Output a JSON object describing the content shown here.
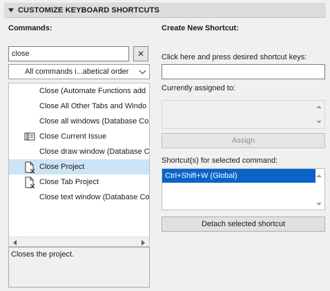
{
  "header": {
    "title": "CUSTOMIZE KEYBOARD SHORTCUTS"
  },
  "commands": {
    "label": "Commands:",
    "search_value": "close",
    "clear_glyph": "✕",
    "filter_value": "All commands i...abetical order",
    "items": [
      {
        "label": "Close (Automate Functions add",
        "icon": "",
        "selected": false
      },
      {
        "label": "Close All Other Tabs and Windo",
        "icon": "",
        "selected": false
      },
      {
        "label": "Close all windows (Database Co",
        "icon": "",
        "selected": false
      },
      {
        "label": "Close Current Issue",
        "icon": "issue-manager-icon",
        "selected": false
      },
      {
        "label": "Close draw window (Database C",
        "icon": "",
        "selected": false
      },
      {
        "label": "Close Project",
        "icon": "close-document-icon",
        "selected": true
      },
      {
        "label": "Close Tab Project",
        "icon": "close-document-icon",
        "selected": false
      },
      {
        "label": "Close text window (Database Co",
        "icon": "",
        "selected": false
      }
    ],
    "description": "Closes the project."
  },
  "create": {
    "label": "Create New Shortcut:",
    "press_prompt": "Click here and press desired shortcut keys:",
    "shortcut_value": "",
    "assigned_label": "Currently assigned to:",
    "assign_button": "Assign",
    "selected_shortcuts_label": "Shortcut(s) for selected command:",
    "shortcuts": [
      "Ctrl+Shift+W (Global)"
    ],
    "detach_button": "Detach selected shortcut"
  },
  "colors": {
    "selection_row": "#cce4f7",
    "selection_shortcut": "#0a64c8",
    "header_bg": "#dcdcdc"
  }
}
